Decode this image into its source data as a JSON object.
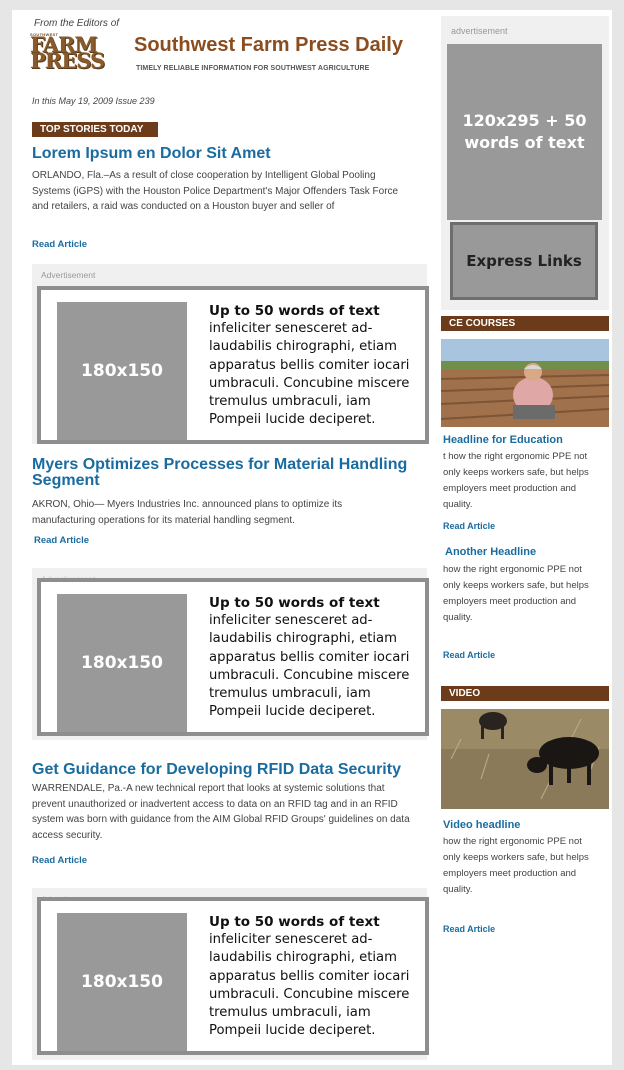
{
  "header": {
    "from_editors": "From the Editors of",
    "logo_small": "SOUTHWEST",
    "logo_line1": "FARM",
    "logo_line2": "PRESS",
    "title": "Southwest Farm Press Daily",
    "tagline": "TIMELY RELIABLE INFORMATION FOR SOUTHWEST AGRICULTURE",
    "issue": "In this May 19, 2009 Issue 239"
  },
  "top_stories_label": "TOP STORIES TODAY",
  "articles": [
    {
      "headline": "Lorem Ipsum en Dolor Sit Amet",
      "body": "ORLANDO, Fla.–As a result of close cooperation by Intelligent Global Pooling Systems (iGPS) with the Houston Police Department's Major Offenders Task Force and retailers, a raid was conducted on a Houston buyer and seller of",
      "read": "Read Article"
    },
    {
      "headline": "Myers Optimizes Processes for Material Handling Segment",
      "body": "AKRON, Ohio— Myers Industries Inc. announced plans to optimize its manufacturing operations for its material handling segment.",
      "read": "Read Article"
    },
    {
      "headline": "Get Guidance for Developing RFID Data Security",
      "body": "WARRENDALE, Pa.-A new technical report that looks at systemic solutions that prevent unauthorized or inadvertent access to data on an RFID tag and in an RFID system was born with guidance from the AIM Global RFID Groups' guidelines on data access security.",
      "read": "Read Article"
    }
  ],
  "ads": [
    {
      "label": "Advertisement",
      "image": "180x150",
      "heading": "Up to 50 words of text",
      "body": "infeliciter senesceret ad-laudabilis chirographi, etiam apparatus bellis comiter iocari umbraculi. Concubine miscere tremulus umbraculi, iam Pompeii lucide deciperet."
    },
    {
      "label": "Advertisement",
      "image": "180x150",
      "heading": "Up to 50 words of text",
      "body": "infeliciter senesceret ad-laudabilis chirographi, etiam apparatus bellis comiter iocari umbraculi. Concubine miscere tremulus umbraculi, iam Pompeii lucide deciperet."
    },
    {
      "label": "Advertisement",
      "image": "180x150",
      "heading": "Up to 50 words of text",
      "body": "infeliciter senesceret ad-laudabilis chirographi, etiam apparatus bellis comiter iocari umbraculi. Concubine miscere tremulus umbraculi, iam Pompeii lucide deciperet."
    }
  ],
  "sidebar": {
    "ad_label": "advertisement",
    "ad_text": "120x295 + 50 words of text",
    "express_links": "Express Links",
    "ce_courses_label": "CE COURSES",
    "ce_items": [
      {
        "headline": "Headline for Education",
        "body": "t how the right ergonomic PPE not only keeps workers safe, but helps employers meet production and quality.",
        "read": "Read Article"
      },
      {
        "headline": "Another Headline",
        "body": "how the right ergonomic PPE not only keeps workers safe, but helps employers meet production and quality.",
        "read": "Read Article"
      }
    ],
    "video_label": "VIDEO",
    "video": {
      "headline": "Video headline",
      "body": "how the right ergonomic PPE not only keeps workers safe, but helps employers meet production and quality.",
      "read": "Read Article"
    }
  },
  "colors": {
    "brand_brown": "#6b3b1a",
    "link_blue": "#1a6ca0",
    "placeholder_gray": "#999999"
  }
}
